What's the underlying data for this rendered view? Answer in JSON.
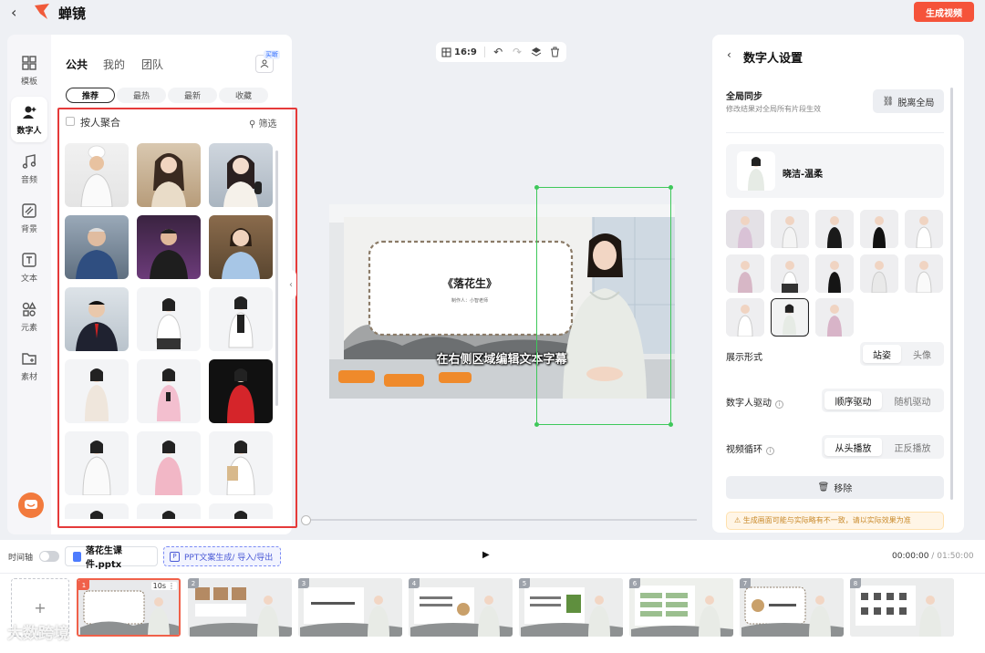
{
  "app": {
    "name": "蝉镜",
    "generate_label": "生成视频"
  },
  "rail": [
    {
      "label": "模板",
      "icon": "grid-icon"
    },
    {
      "label": "数字人",
      "icon": "digital-human-icon",
      "active": true
    },
    {
      "label": "音频",
      "icon": "music-icon"
    },
    {
      "label": "背景",
      "icon": "background-icon"
    },
    {
      "label": "文本",
      "icon": "text-icon"
    },
    {
      "label": "元素",
      "icon": "elements-icon"
    },
    {
      "label": "素材",
      "icon": "folder-icon"
    }
  ],
  "left_panel": {
    "tabs": [
      "公共",
      "我的",
      "团队"
    ],
    "new_badge": "买断",
    "filters": [
      "推荐",
      "最热",
      "最新",
      "收藏"
    ],
    "group_by_person": "按人聚合",
    "filter_label": "筛选"
  },
  "canvas": {
    "ratio": "16:9",
    "slide_title": "《落花生》",
    "slide_author": "制作人：小智老师",
    "subtitle": "在右侧区域编辑文本字幕"
  },
  "right_panel": {
    "title": "数字人设置",
    "global_sync": {
      "title": "全局同步",
      "subtitle": "修改结果对全局所有片段生效",
      "button": "脱离全局"
    },
    "current_avatar": "晓洁-温柔",
    "display": {
      "label": "展示形式",
      "options": [
        "站姿",
        "头像"
      ],
      "selected": "站姿"
    },
    "drive": {
      "label": "数字人驱动",
      "options": [
        "顺序驱动",
        "随机驱动"
      ],
      "selected": "顺序驱动"
    },
    "loop": {
      "label": "视频循环",
      "options": [
        "从头播放",
        "正反播放"
      ],
      "selected": "从头播放"
    },
    "remove_label": "移除",
    "notice": "生成画面可能与实际略有不一致，请以实际效果为准"
  },
  "timeline": {
    "label": "时间轴",
    "file_name": "落花生课件.pptx",
    "ppt_action": "PPT文案生成/ 导入/导出",
    "current_time": "00:00:00",
    "total_time": "01:50:00",
    "first_duration": "10s",
    "frames": [
      "1",
      "2",
      "3",
      "4",
      "5",
      "6",
      "7",
      "8"
    ]
  },
  "watermark": "大数跨境",
  "colors": {
    "accent": "#f5533a",
    "selection": "#e53a3a",
    "frame_green": "#3ec85a"
  }
}
